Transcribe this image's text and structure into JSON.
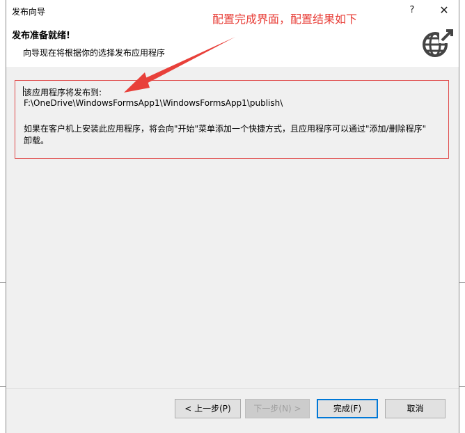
{
  "window": {
    "title": "发布向导",
    "help_label": "?",
    "close_label": "✕"
  },
  "header": {
    "title": "发布准备就绪!",
    "subtitle": "向导现在将根据你的选择发布应用程序",
    "icon": "globe-publish-icon"
  },
  "content": {
    "line1": "该应用程序将发布到:",
    "line2": "F:\\OneDrive\\WindowsFormsApp1\\WindowsFormsApp1\\publish\\",
    "line3": "如果在客户机上安装此应用程序，将会向\"开始\"菜单添加一个快捷方式，且应用程序可以通过\"添加/删除程序\"",
    "line4": "卸载。"
  },
  "annotation": {
    "text": "配置完成界面，配置结果如下",
    "color": "#e8403a"
  },
  "buttons": {
    "prev": "< 上一步(P)",
    "next": "下一步(N) >",
    "finish": "完成(F)",
    "cancel": "取消"
  },
  "colors": {
    "accent": "#0078d7",
    "highlight_border": "#e04a4a"
  }
}
